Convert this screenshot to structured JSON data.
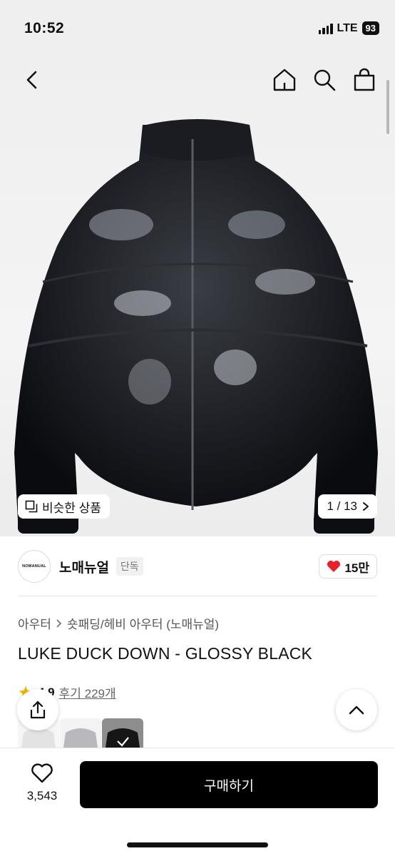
{
  "status": {
    "time": "10:52",
    "network": "LTE",
    "battery": "93"
  },
  "hero": {
    "counter": "1 / 13",
    "similar_label": "비슷한 상품"
  },
  "brand": {
    "logo_text": "NOMANUAL",
    "name": "노매뉴얼",
    "badge": "단독",
    "likes": "15만"
  },
  "breadcrumb": {
    "category": "아우터",
    "subcategory": "숏패딩/헤비 아우터 (노매뉴얼)"
  },
  "product": {
    "title": "LUKE DUCK DOWN - GLOSSY BLACK"
  },
  "rating": {
    "value": "4.9",
    "reviews": "후기 229개"
  },
  "thumbnails": [
    {
      "name": "white",
      "color": "#ececec"
    },
    {
      "name": "silver",
      "color": "#bdbdbd"
    },
    {
      "name": "black",
      "color": "#161616",
      "selected": true
    }
  ],
  "bottom": {
    "wish_count": "3,543",
    "buy_label": "구매하기"
  },
  "colors": {
    "accent": "#000000",
    "heart": "#e8202a",
    "star": "#f5b400"
  },
  "icons": [
    "back-icon",
    "home-icon",
    "search-icon",
    "bag-icon",
    "similar-icon",
    "chevron-right-icon",
    "heart-icon",
    "share-icon",
    "chevron-up-icon",
    "star-icon"
  ]
}
